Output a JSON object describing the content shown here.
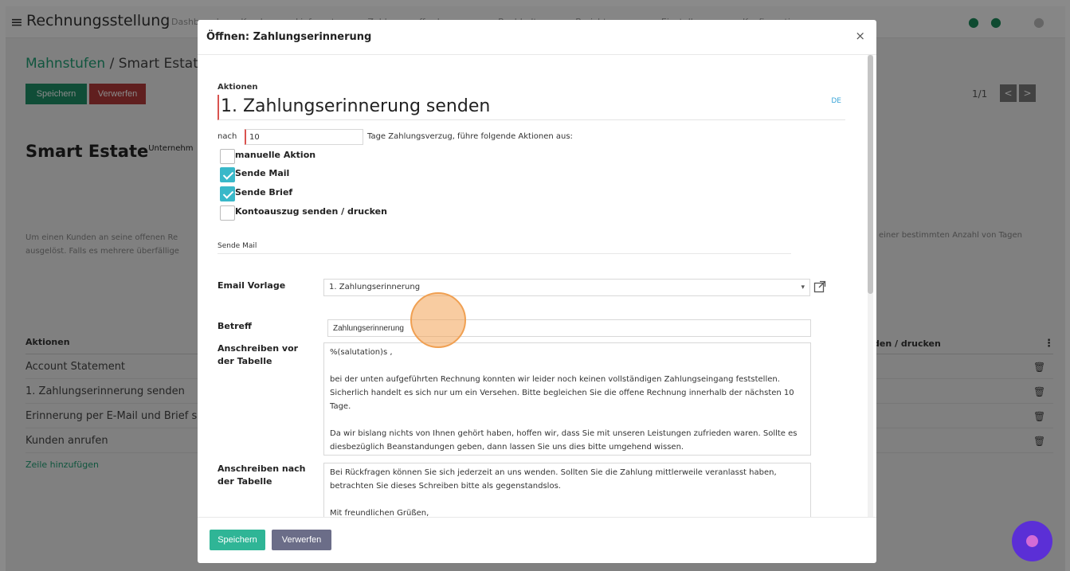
{
  "app": {
    "title": "Rechnungsstellung",
    "nav": [
      "Dashboard",
      "Kunden",
      "Lieferanten",
      "Zahlungsaufforderungen",
      "Buchhaltung",
      "Berichtswesen",
      "Einstellungen",
      "Konfiguration"
    ]
  },
  "breadcrumb": {
    "parent": "Mahnstufen",
    "separator": "/",
    "current": "Smart Estate"
  },
  "background_buttons": {
    "save": "Speichern",
    "discard": "Verwerfen"
  },
  "pager": {
    "text": "1/1",
    "prev": "<",
    "next": ">"
  },
  "record": {
    "title": "Smart Estate",
    "superscript": "Unternehm"
  },
  "description": {
    "left": "Um einen Kunden an seine offenen Re ausgelöst. Falls es mehrere überfällige",
    "right": "einer bestimmten Anzahl von Tagen"
  },
  "actions_table": {
    "header": "Aktionen",
    "header_right": "den / drucken",
    "kebab": "⋮",
    "rows": [
      "Account Statement",
      "1. Zahlungserinnerung senden",
      "Erinnerung per E-Mail und Brief s",
      "Kunden anrufen"
    ],
    "add_row": "Zeile hinzufügen"
  },
  "modal": {
    "title": "Öffnen: Zahlungserinnerung",
    "close": "×",
    "section_actions": "Aktionen",
    "action_name": "1. Zahlungserinnerung senden",
    "lang_tag": "DE",
    "after_label": "nach",
    "days_value": "10",
    "days_text": "Tage Zahlungsverzug, führe folgende Aktionen aus:",
    "checkboxes": [
      {
        "label": "manuelle Aktion",
        "checked": false
      },
      {
        "label": "Sende Mail",
        "checked": true
      },
      {
        "label": "Sende Brief",
        "checked": true
      },
      {
        "label": "Kontoauszug senden / drucken",
        "checked": false
      }
    ],
    "section_mail": "Sende Mail",
    "email_template_label": "Email Vorlage",
    "email_template_value": "1. Zahlungserinnerung",
    "subject_label": "Betreff",
    "subject_value": "Zahlungserinnerung",
    "before_table_label": "Anschreiben vor der Tabelle",
    "before_table_paragraphs": [
      "%(salutation)s ,",
      "bei der unten aufgeführten Rechnung konnten wir leider noch keinen vollständigen Zahlungseingang feststellen. Sicherlich handelt es sich nur um ein Versehen. Bitte begleichen Sie die offene Rechnung innerhalb der nächsten 10 Tage.",
      "Da wir bislang nichts von Ihnen gehört haben, hoffen wir, dass Sie mit unseren Leistungen zufrieden waren. Sollte es diesbezüglich Beanstandungen geben, dann lassen Sie uns dies bitte umgehend wissen."
    ],
    "after_table_label": "Anschreiben nach der Tabelle",
    "after_table_paragraphs": [
      "Bei Rückfragen können Sie sich jederzeit an uns wenden. Sollten Sie die Zahlung mittlerweile veranlasst haben, betrachten Sie dieses Schreiben bitte als gegenstandslos.",
      "Mit freundlichen Grüßen,\n%(user_signature)s"
    ],
    "footer": {
      "save": "Speichern",
      "discard": "Verwerfen"
    }
  },
  "icons": {
    "menu": "hamburger-icon",
    "close": "close-icon",
    "caret": "chevron-down-icon",
    "external": "external-link-icon",
    "trash": "trash-icon",
    "chat": "chat-icon"
  },
  "colors": {
    "primary_green": "#1f9e73",
    "modal_save": "#2fb596",
    "modal_discard": "#6b6d88",
    "checkbox_checked": "#39b8c9",
    "required_marker": "#d9534f",
    "chat_bubble": "#5b2fd6"
  }
}
